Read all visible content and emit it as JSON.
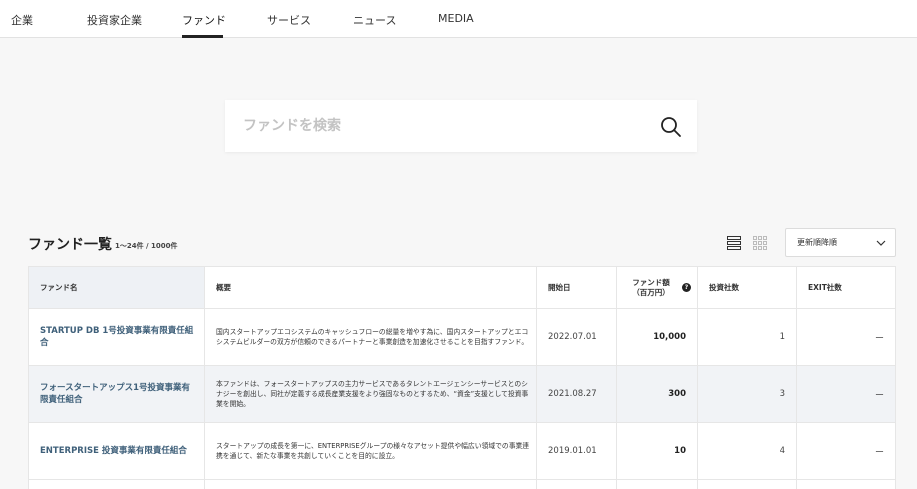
{
  "nav": {
    "items": [
      {
        "label": "企業"
      },
      {
        "label": "投資家企業"
      },
      {
        "label": "ファンド"
      },
      {
        "label": "サービス"
      },
      {
        "label": "ニュース"
      },
      {
        "label": "MEDIA"
      }
    ],
    "active": "ファンド"
  },
  "search": {
    "placeholder": "ファンドを検索",
    "value": ""
  },
  "list": {
    "title": "ファンド一覧",
    "count": "1～24件 / 1000件"
  },
  "sort": {
    "selected": "更新順降順"
  },
  "table": {
    "headers": {
      "name": "ファンド名",
      "desc": "概要",
      "date": "開始日",
      "amount_line1": "ファンド額",
      "amount_line2": "（百万円）",
      "investments": "投資社数",
      "exits": "EXIT社数"
    },
    "rows": [
      {
        "name": "STARTUP DB 1号投資事業有限責任組合",
        "desc": "国内スタートアップエコシステムのキャッシュフローの総量を増やす為に、国内スタートアップとエコシステムビルダーの双方が信頼のできるパートナーと事業創造を加速化させることを目指すファンド。",
        "date": "2022.07.01",
        "amount": "10,000",
        "investments": "1",
        "exits": "ー"
      },
      {
        "name": "フォースタートアップス1号投資事業有限責任組合",
        "desc": "本ファンドは、フォースタートアップスの主力サービスであるタレントエージェンシーサービスとのシナジーを創出し、同社が定義する成長産業支援をより強固なものとするため、“資金”支援として投資事業を開始。",
        "date": "2021.08.27",
        "amount": "300",
        "investments": "3",
        "exits": "ー"
      },
      {
        "name": "ENTERPRISE 投資事業有限責任組合",
        "desc": "スタートアップの成長を第一に、ENTERPRISEグループの様々なアセット提供や幅広い領域での事業連携を通じて、新たな事業を共創していくことを目的に設立。",
        "date": "2019.01.01",
        "amount": "10",
        "investments": "4",
        "exits": "ー"
      }
    ]
  },
  "icons": {
    "search": "search-icon",
    "list_view": "list-view-icon",
    "grid_view": "grid-view-icon",
    "chevron": "chevron-down-icon",
    "help": "help-icon"
  },
  "colors": {
    "link": "#3f607a",
    "header_name_bg": "#eef1f5",
    "row_shade": "#f1f3f6"
  }
}
